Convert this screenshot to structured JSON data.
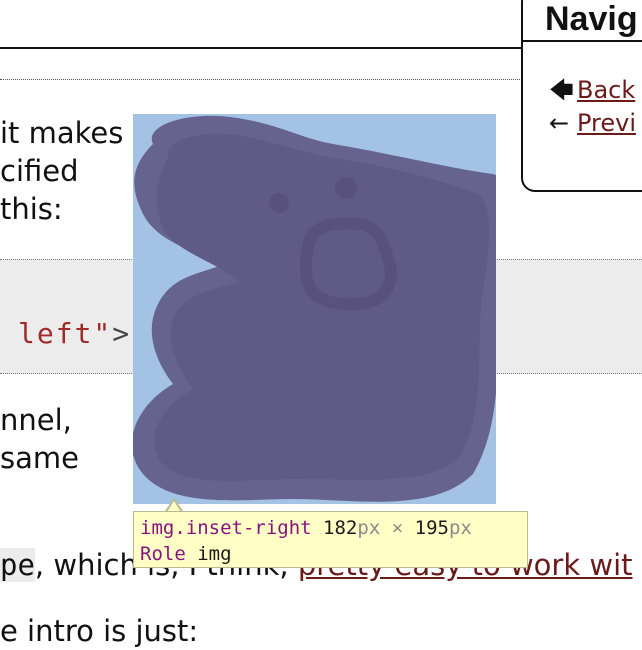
{
  "navigation": {
    "title": "Navig",
    "items": [
      {
        "icon": "back-arrow-icon",
        "glyph": "🡄",
        "label": "Back"
      },
      {
        "icon": "left-arrow-icon",
        "glyph": "←",
        "label": "Previ"
      }
    ]
  },
  "article": {
    "para1": [
      "it makes",
      "cified",
      "this:"
    ],
    "code": {
      "str": "left\"",
      "punct": ">"
    },
    "para2": [
      "nnel,",
      "same"
    ],
    "para3": {
      "code": "pe",
      "text": ", which is, I think, ",
      "link": "pretty easy to work wit"
    },
    "para4": "e intro is just:"
  },
  "inspector": {
    "selector": "img.inset-right",
    "width": "182",
    "height": "195",
    "unit": "px",
    "times": "×",
    "role_label": "Role",
    "role_value": "img"
  },
  "colors": {
    "highlight": "#a4c2e3",
    "image_fill": "#5f5a85",
    "link": "#6b1a1a",
    "tooltip_bg": "#ffffc6"
  }
}
